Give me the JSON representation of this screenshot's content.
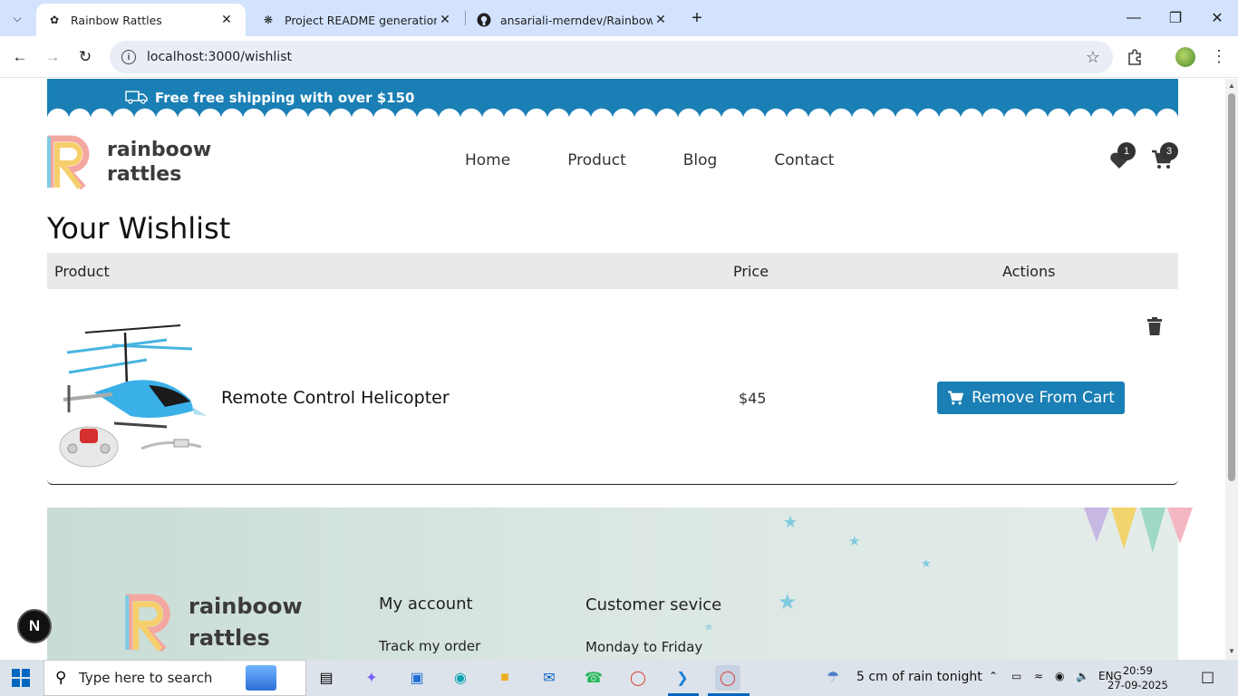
{
  "browser": {
    "tabs": [
      {
        "title": "Rainbow Rattles",
        "active": true
      },
      {
        "title": "Project README generation",
        "active": false
      },
      {
        "title": "ansariali-merndev/Rainbow-Rat",
        "active": false
      }
    ],
    "url": "localhost:3000/wishlist"
  },
  "site": {
    "promo_text": "Free  free shipping with over $150",
    "logo_line1": "rainboow",
    "logo_line2": "rattles",
    "nav": [
      "Home",
      "Product",
      "Blog",
      "Contact"
    ],
    "wishlist_count": "1",
    "cart_count": "3"
  },
  "wishlist": {
    "title": "Your Wishlist",
    "columns": {
      "product": "Product",
      "price": "Price",
      "actions": "Actions"
    },
    "items": [
      {
        "name": "Remote Control Helicopter",
        "price": "$45",
        "action_label": "Remove From Cart"
      }
    ]
  },
  "footer": {
    "logo_line1": "rainboow",
    "logo_line2": "rattles",
    "account_title": "My account",
    "account_item1": "Track my order",
    "service_title": "Customer sevice",
    "service_item1": "Monday to Friday"
  },
  "floating_button_label": "N",
  "taskbar": {
    "search_placeholder": "Type here to search",
    "weather": "5 cm of rain tonight",
    "language": "ENG",
    "time": "20:59",
    "date": "27-09-2025"
  },
  "colors": {
    "brand_blue": "#1a7fb4",
    "table_header_bg": "#e9e9e9",
    "tabbar_bg": "#d3e3fd"
  }
}
